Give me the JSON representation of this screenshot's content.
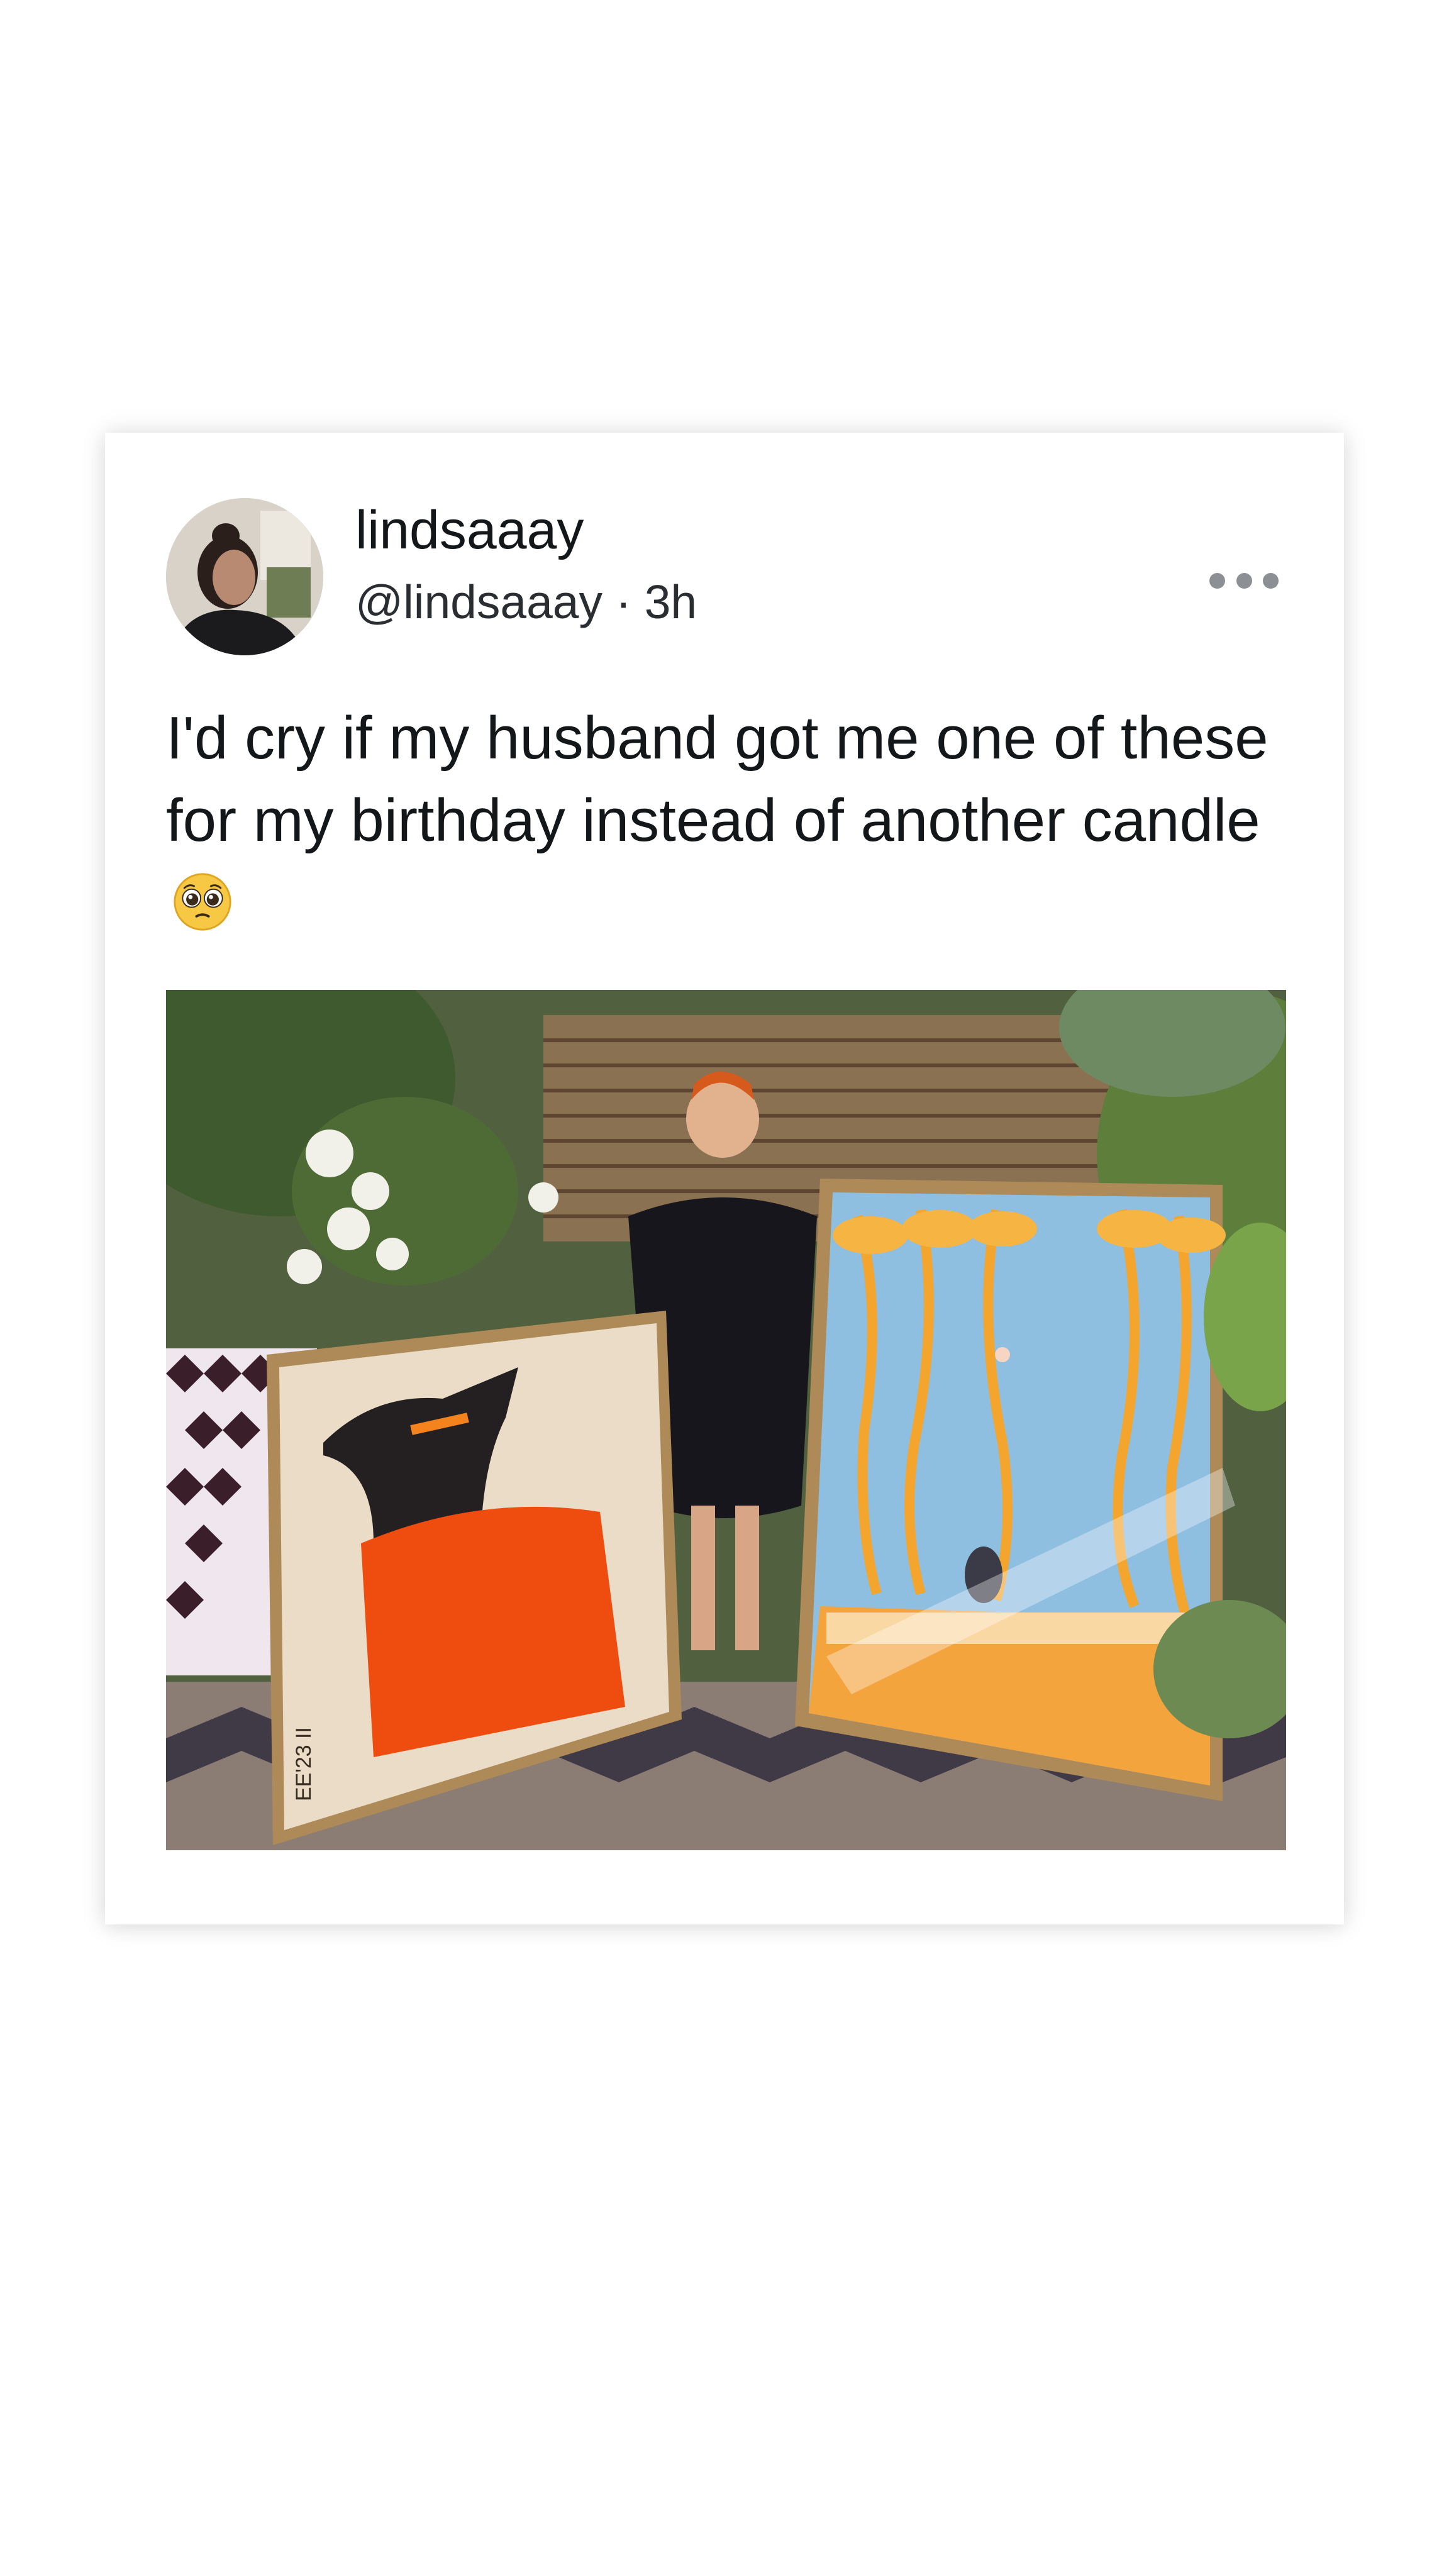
{
  "post": {
    "display_name": "lindsaaay",
    "handle": "@lindsaaay",
    "separator": "·",
    "time": "3h",
    "text": "I'd cry if my husband got me one of these for my birthday instead of another candle",
    "emoji": "pleading-face-emoji"
  },
  "icons": {
    "more": "more-horizontal-icon",
    "avatar": "profile-photo"
  },
  "colors": {
    "text": "#14171a",
    "muted": "#8c8f94",
    "card": "#ffffff"
  },
  "media": {
    "painting_left_inscription": "EE'23 II"
  }
}
